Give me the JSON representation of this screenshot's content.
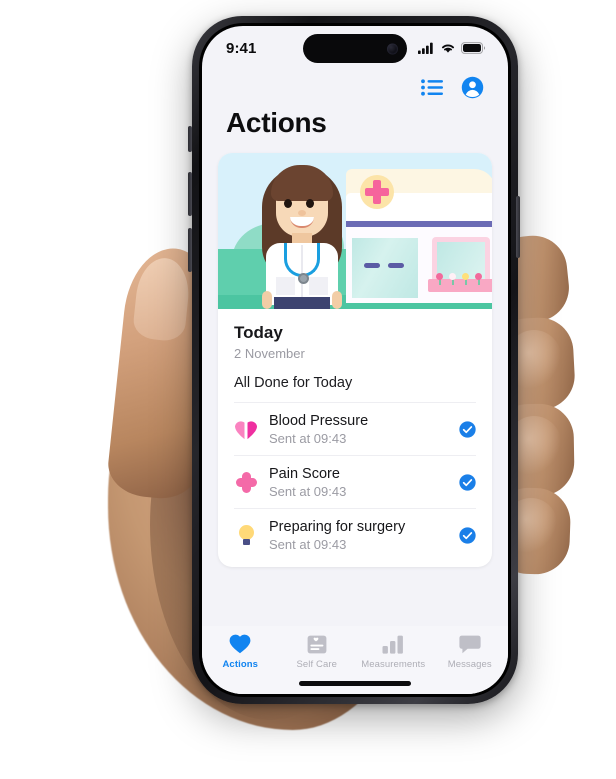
{
  "statusbar": {
    "time": "9:41",
    "cellular_icon": "cellular-bars-icon",
    "wifi_icon": "wifi-icon",
    "battery_icon": "battery-icon"
  },
  "header": {
    "title": "Actions",
    "list_icon": "list-icon",
    "account_icon": "account-circle-icon"
  },
  "illustration": {
    "name": "nurse-clinic-illustration",
    "sky_color": "#d8f1fb",
    "ground_color": "#5fcfad",
    "bush_color": "#8fdcc6",
    "cross_color": "#f6649c"
  },
  "card": {
    "today_label": "Today",
    "date": "2 November",
    "status_text": "All Done for Today",
    "items": [
      {
        "icon": "heart-icon",
        "title": "Blood Pressure",
        "subtitle": "Sent at 09:43",
        "checked": true
      },
      {
        "icon": "cross-icon",
        "title": "Pain Score",
        "subtitle": "Sent at 09:43",
        "checked": true
      },
      {
        "icon": "lightbulb-icon",
        "title": "Preparing for surgery",
        "subtitle": "Sent at 09:43",
        "checked": true
      }
    ],
    "check_color": "#1a7fe8"
  },
  "tabbar": {
    "active_color": "#1184f0",
    "inactive_color": "#aeaeb6",
    "tabs": [
      {
        "label": "Actions",
        "icon": "heart-icon",
        "active": true
      },
      {
        "label": "Self Care",
        "icon": "note-card-icon",
        "active": false
      },
      {
        "label": "Measurements",
        "icon": "bar-chart-icon",
        "active": false
      },
      {
        "label": "Messages",
        "icon": "chat-bubble-icon",
        "active": false
      }
    ]
  }
}
